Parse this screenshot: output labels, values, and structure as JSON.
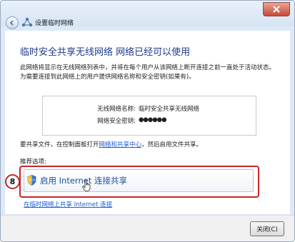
{
  "window": {
    "title": "设置临时网络"
  },
  "main": {
    "heading": "临时安全共享无线网络 网络已经可以使用",
    "description": "此网络将显示在无线网络列表中，并将在每个用户从该网络上断开连接之前一直处于活动状态。为需要连接到此网络上的用户提供网络名称和安全密钥(如果有)。",
    "network_name_label": "无线网络名称:",
    "network_name_value": "临时安全共享无线网络",
    "security_key_label": "网络安全密钥:",
    "security_key_value": "●●●●●●",
    "share_prefix": "要共享文件，在控制面板打开",
    "share_link": "网络和共享中心",
    "share_suffix": "，然后启用文件共享。",
    "recommended_label": "推荐选项:",
    "option_label": "启用 Internet 连接共享",
    "bottom_link": "在临时网络上共享 Internet 连接"
  },
  "annotation": {
    "step_number": "8",
    "highlight_color": "#c42727"
  },
  "footer": {
    "close_label": "关闭(C)"
  },
  "icons": {
    "back": "back-arrow-icon",
    "network": "network-icon",
    "window_close": "close-icon",
    "option": "shield-icon",
    "pointer": "hand-cursor-icon"
  }
}
